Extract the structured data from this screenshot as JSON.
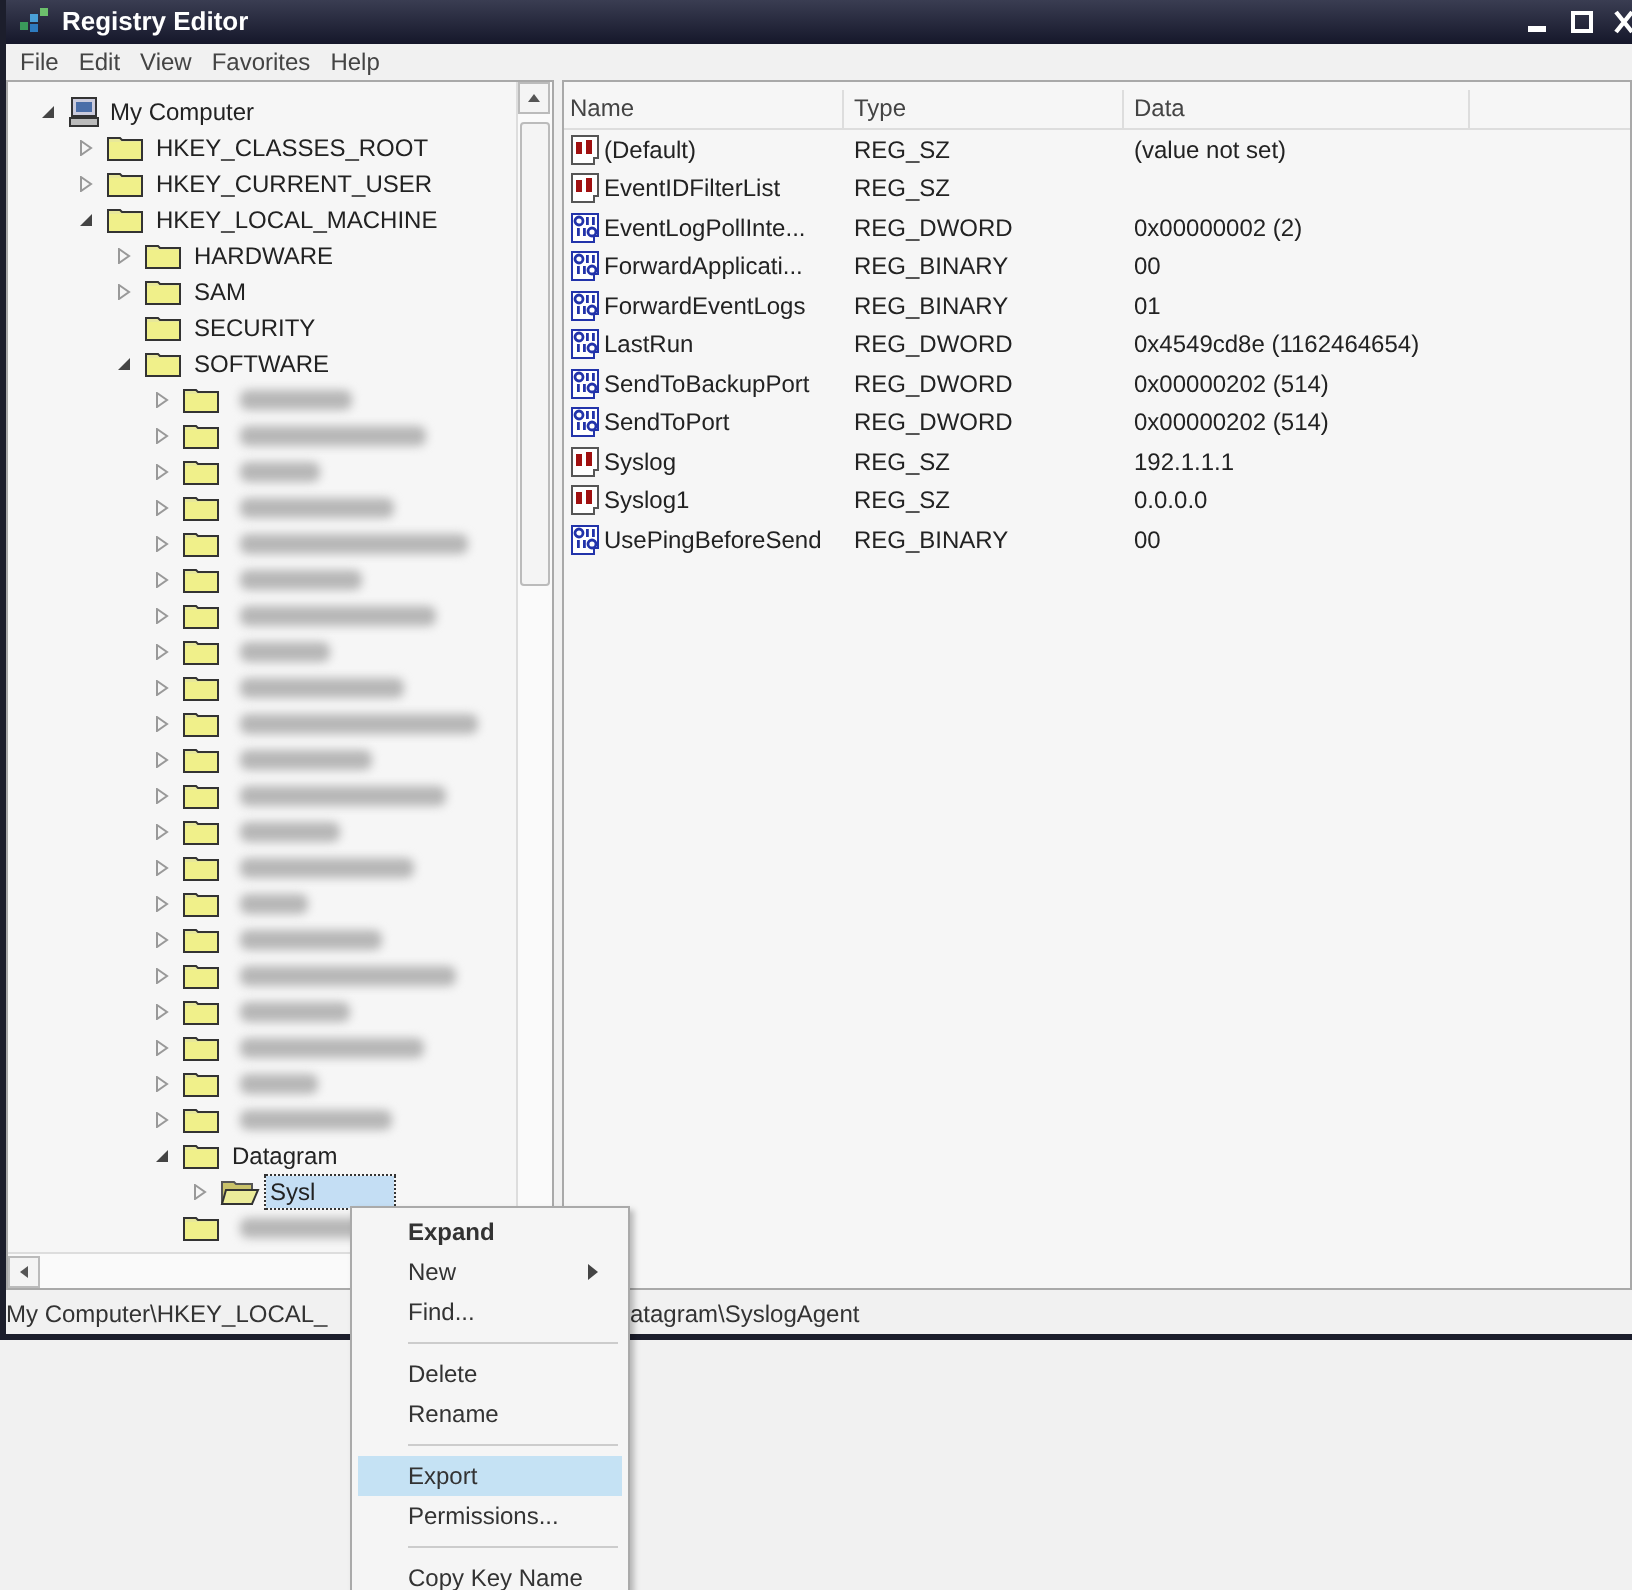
{
  "window": {
    "title": "Registry Editor"
  },
  "menu_bar": [
    "File",
    "Edit",
    "View",
    "Favorites",
    "Help"
  ],
  "tree": [
    {
      "label": "My Computer",
      "kind": "computer",
      "expanded": true,
      "selected": false,
      "children": [
        {
          "kind": "key",
          "label": "HKEY_CLASSES_ROOT",
          "expanded": false,
          "selected": false
        },
        {
          "kind": "key",
          "label": "HKEY_CURRENT_USER",
          "expanded": false,
          "selected": false
        },
        {
          "kind": "key",
          "label": "HKEY_LOCAL_MACHINE",
          "expanded": true,
          "selected": false,
          "children": [
            {
              "kind": "key",
              "label": "HARDWARE",
              "expanded": false,
              "selected": false
            },
            {
              "kind": "key",
              "label": "SAM",
              "expanded": false,
              "selected": false
            },
            {
              "kind": "key",
              "label": "SECURITY",
              "selected": false
            },
            {
              "kind": "key",
              "label": "SOFTWARE",
              "expanded": true,
              "selected": false,
              "children": [
                {
                  "kind": "blurred",
                  "expanded": false,
                  "selected": false
                },
                {
                  "kind": "blurred",
                  "expanded": false,
                  "selected": false
                },
                {
                  "kind": "blurred",
                  "expanded": false,
                  "selected": false
                },
                {
                  "kind": "blurred",
                  "expanded": false,
                  "selected": false
                },
                {
                  "kind": "blurred",
                  "expanded": false,
                  "selected": false
                },
                {
                  "kind": "blurred",
                  "expanded": false,
                  "selected": false
                },
                {
                  "kind": "blurred",
                  "expanded": false,
                  "selected": false
                },
                {
                  "kind": "blurred",
                  "expanded": false,
                  "selected": false
                },
                {
                  "kind": "blurred",
                  "expanded": false,
                  "selected": false
                },
                {
                  "kind": "blurred",
                  "expanded": false,
                  "selected": false
                },
                {
                  "kind": "blurred",
                  "expanded": false,
                  "selected": false
                },
                {
                  "kind": "blurred",
                  "expanded": false,
                  "selected": false
                },
                {
                  "kind": "blurred",
                  "expanded": false,
                  "selected": false
                },
                {
                  "kind": "blurred",
                  "expanded": false,
                  "selected": false
                },
                {
                  "kind": "blurred",
                  "expanded": false,
                  "selected": false
                },
                {
                  "kind": "blurred",
                  "expanded": false,
                  "selected": false
                },
                {
                  "kind": "blurred",
                  "expanded": false,
                  "selected": false
                },
                {
                  "kind": "blurred",
                  "expanded": false,
                  "selected": false
                },
                {
                  "kind": "blurred",
                  "expanded": false,
                  "selected": false
                },
                {
                  "kind": "blurred",
                  "expanded": false,
                  "selected": false
                },
                {
                  "kind": "blurred",
                  "expanded": false,
                  "selected": false
                },
                {
                  "kind": "key",
                  "label": "Datagram",
                  "expanded": true,
                  "selected": false,
                  "children": [
                    {
                      "kind": "key",
                      "label": "Sysl",
                      "expanded": false,
                      "selected": true
                    }
                  ]
                },
                {
                  "kind": "blurred",
                  "selected": false
                }
              ]
            }
          ]
        }
      ]
    }
  ],
  "table": {
    "columns": [
      "Name",
      "Type",
      "Data"
    ],
    "rows": [
      {
        "kind": "string",
        "name": "(Default)",
        "type": "REG_SZ",
        "data": "(value not set)"
      },
      {
        "kind": "string",
        "name": "EventIDFilterList",
        "type": "REG_SZ"
      },
      {
        "kind": "binary",
        "name": "EventLogPollInte...",
        "type": "REG_DWORD",
        "data": "0x00000002 (2)"
      },
      {
        "kind": "binary",
        "name": "ForwardApplicati...",
        "type": "REG_BINARY",
        "data": "00"
      },
      {
        "kind": "binary",
        "name": "ForwardEventLogs",
        "type": "REG_BINARY",
        "data": "01"
      },
      {
        "kind": "binary",
        "name": "LastRun",
        "type": "REG_DWORD",
        "data": "0x4549cd8e (1162464654)"
      },
      {
        "kind": "binary",
        "name": "SendToBackupPort",
        "type": "REG_DWORD",
        "data": "0x00000202 (514)"
      },
      {
        "kind": "binary",
        "name": "SendToPort",
        "type": "REG_DWORD",
        "data": "0x00000202 (514)"
      },
      {
        "kind": "string",
        "name": "Syslog",
        "type": "REG_SZ",
        "data": "192.1.1.1"
      },
      {
        "kind": "string",
        "name": "Syslog1",
        "type": "REG_SZ",
        "data": "0.0.0.0"
      },
      {
        "kind": "binary",
        "name": "UsePingBeforeSend",
        "type": "REG_BINARY",
        "data": "00"
      }
    ]
  },
  "status_bar": [
    "My Computer\\HKEY_LOCAL_",
    "atagram\\SyslogAgent"
  ],
  "context_menu": [
    {
      "kind": "item",
      "label": "Expand",
      "bold": true,
      "submenu": false,
      "selected": false
    },
    {
      "kind": "item",
      "label": "New",
      "bold": false,
      "submenu": true,
      "selected": false
    },
    {
      "kind": "item",
      "label": "Find...",
      "bold": false,
      "submenu": false,
      "selected": false
    },
    {
      "kind": "separator"
    },
    {
      "kind": "item",
      "label": "Delete",
      "bold": false,
      "submenu": false,
      "selected": false
    },
    {
      "kind": "item",
      "label": "Rename",
      "bold": false,
      "submenu": false,
      "selected": false
    },
    {
      "kind": "separator"
    },
    {
      "kind": "item",
      "label": "Export",
      "bold": false,
      "submenu": false,
      "selected": true
    },
    {
      "kind": "item",
      "label": "Permissions...",
      "bold": false,
      "submenu": false,
      "selected": false
    },
    {
      "kind": "separator"
    },
    {
      "kind": "item",
      "label": "Copy Key Name",
      "bold": false,
      "submenu": false,
      "selected": false
    }
  ]
}
